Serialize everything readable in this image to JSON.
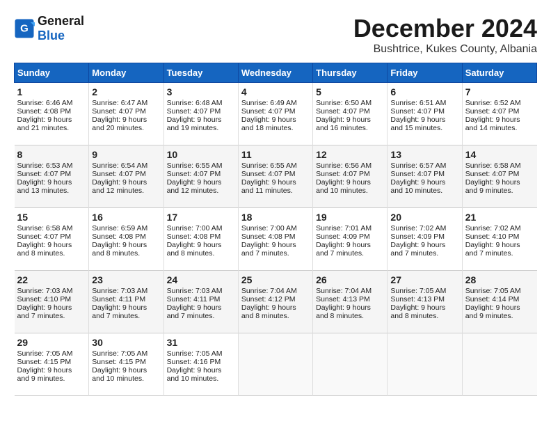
{
  "logo": {
    "line1": "General",
    "line2": "Blue"
  },
  "title": "December 2024",
  "subtitle": "Bushtrice, Kukes County, Albania",
  "days_of_week": [
    "Sunday",
    "Monday",
    "Tuesday",
    "Wednesday",
    "Thursday",
    "Friday",
    "Saturday"
  ],
  "weeks": [
    [
      {
        "day": "1",
        "sunrise": "6:46 AM",
        "sunset": "4:08 PM",
        "daylight": "9 hours and 21 minutes."
      },
      {
        "day": "2",
        "sunrise": "6:47 AM",
        "sunset": "4:07 PM",
        "daylight": "9 hours and 20 minutes."
      },
      {
        "day": "3",
        "sunrise": "6:48 AM",
        "sunset": "4:07 PM",
        "daylight": "9 hours and 19 minutes."
      },
      {
        "day": "4",
        "sunrise": "6:49 AM",
        "sunset": "4:07 PM",
        "daylight": "9 hours and 18 minutes."
      },
      {
        "day": "5",
        "sunrise": "6:50 AM",
        "sunset": "4:07 PM",
        "daylight": "9 hours and 16 minutes."
      },
      {
        "day": "6",
        "sunrise": "6:51 AM",
        "sunset": "4:07 PM",
        "daylight": "9 hours and 15 minutes."
      },
      {
        "day": "7",
        "sunrise": "6:52 AM",
        "sunset": "4:07 PM",
        "daylight": "9 hours and 14 minutes."
      }
    ],
    [
      {
        "day": "8",
        "sunrise": "6:53 AM",
        "sunset": "4:07 PM",
        "daylight": "9 hours and 13 minutes."
      },
      {
        "day": "9",
        "sunrise": "6:54 AM",
        "sunset": "4:07 PM",
        "daylight": "9 hours and 12 minutes."
      },
      {
        "day": "10",
        "sunrise": "6:55 AM",
        "sunset": "4:07 PM",
        "daylight": "9 hours and 12 minutes."
      },
      {
        "day": "11",
        "sunrise": "6:55 AM",
        "sunset": "4:07 PM",
        "daylight": "9 hours and 11 minutes."
      },
      {
        "day": "12",
        "sunrise": "6:56 AM",
        "sunset": "4:07 PM",
        "daylight": "9 hours and 10 minutes."
      },
      {
        "day": "13",
        "sunrise": "6:57 AM",
        "sunset": "4:07 PM",
        "daylight": "9 hours and 10 minutes."
      },
      {
        "day": "14",
        "sunrise": "6:58 AM",
        "sunset": "4:07 PM",
        "daylight": "9 hours and 9 minutes."
      }
    ],
    [
      {
        "day": "15",
        "sunrise": "6:58 AM",
        "sunset": "4:07 PM",
        "daylight": "9 hours and 8 minutes."
      },
      {
        "day": "16",
        "sunrise": "6:59 AM",
        "sunset": "4:08 PM",
        "daylight": "9 hours and 8 minutes."
      },
      {
        "day": "17",
        "sunrise": "7:00 AM",
        "sunset": "4:08 PM",
        "daylight": "9 hours and 8 minutes."
      },
      {
        "day": "18",
        "sunrise": "7:00 AM",
        "sunset": "4:08 PM",
        "daylight": "9 hours and 7 minutes."
      },
      {
        "day": "19",
        "sunrise": "7:01 AM",
        "sunset": "4:09 PM",
        "daylight": "9 hours and 7 minutes."
      },
      {
        "day": "20",
        "sunrise": "7:02 AM",
        "sunset": "4:09 PM",
        "daylight": "9 hours and 7 minutes."
      },
      {
        "day": "21",
        "sunrise": "7:02 AM",
        "sunset": "4:10 PM",
        "daylight": "9 hours and 7 minutes."
      }
    ],
    [
      {
        "day": "22",
        "sunrise": "7:03 AM",
        "sunset": "4:10 PM",
        "daylight": "9 hours and 7 minutes."
      },
      {
        "day": "23",
        "sunrise": "7:03 AM",
        "sunset": "4:11 PM",
        "daylight": "9 hours and 7 minutes."
      },
      {
        "day": "24",
        "sunrise": "7:03 AM",
        "sunset": "4:11 PM",
        "daylight": "9 hours and 7 minutes."
      },
      {
        "day": "25",
        "sunrise": "7:04 AM",
        "sunset": "4:12 PM",
        "daylight": "9 hours and 8 minutes."
      },
      {
        "day": "26",
        "sunrise": "7:04 AM",
        "sunset": "4:13 PM",
        "daylight": "9 hours and 8 minutes."
      },
      {
        "day": "27",
        "sunrise": "7:05 AM",
        "sunset": "4:13 PM",
        "daylight": "9 hours and 8 minutes."
      },
      {
        "day": "28",
        "sunrise": "7:05 AM",
        "sunset": "4:14 PM",
        "daylight": "9 hours and 9 minutes."
      }
    ],
    [
      {
        "day": "29",
        "sunrise": "7:05 AM",
        "sunset": "4:15 PM",
        "daylight": "9 hours and 9 minutes."
      },
      {
        "day": "30",
        "sunrise": "7:05 AM",
        "sunset": "4:15 PM",
        "daylight": "9 hours and 10 minutes."
      },
      {
        "day": "31",
        "sunrise": "7:05 AM",
        "sunset": "4:16 PM",
        "daylight": "9 hours and 10 minutes."
      },
      null,
      null,
      null,
      null
    ]
  ]
}
